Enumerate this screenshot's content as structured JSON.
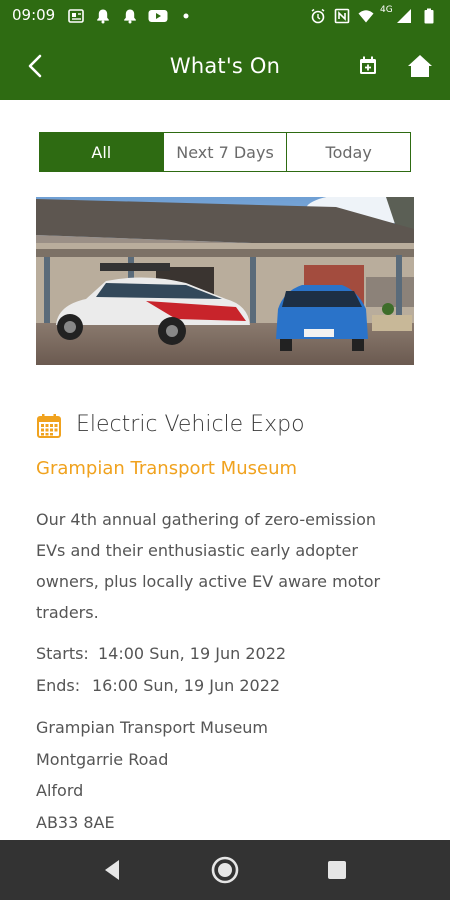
{
  "status_bar": {
    "time": "09:09",
    "network": "4G",
    "left_icons": [
      "news-icon",
      "notification-icon",
      "notification-icon",
      "youtube-icon",
      "dot-icon"
    ],
    "right_icons": [
      "alarm-icon",
      "nfc-icon",
      "wifi-icon",
      "signal-icon",
      "battery-icon"
    ]
  },
  "app_bar": {
    "title": "What's On",
    "back_icon": "back-arrow-icon",
    "calendar_add_icon": "calendar-add-icon",
    "home_icon": "home-icon"
  },
  "tabs": [
    {
      "label": "All",
      "active": true
    },
    {
      "label": "Next 7 Days",
      "active": false
    },
    {
      "label": "Today",
      "active": false
    }
  ],
  "event": {
    "title": "Electric Vehicle Expo",
    "venue": "Grampian Transport Museum",
    "description": "Our 4th annual gathering of zero-emission EVs and their enthusiastic early adopter owners, plus locally active EV aware motor traders.",
    "starts_label": "Starts:",
    "starts_value": "14:00 Sun, 19 Jun 2022",
    "ends_label": "Ends:",
    "ends_value": "16:00 Sun, 19 Jun 2022",
    "address": [
      "Grampian Transport Museum",
      "Montgarrie Road",
      "Alford",
      "AB33 8AE"
    ]
  },
  "colors": {
    "brand_green": "#2e6b12",
    "venue_orange": "#f0a21e",
    "nav_bar": "#333333"
  },
  "nav_bar": {
    "icons": [
      "nav-back-icon",
      "nav-home-icon",
      "nav-recents-icon"
    ]
  }
}
